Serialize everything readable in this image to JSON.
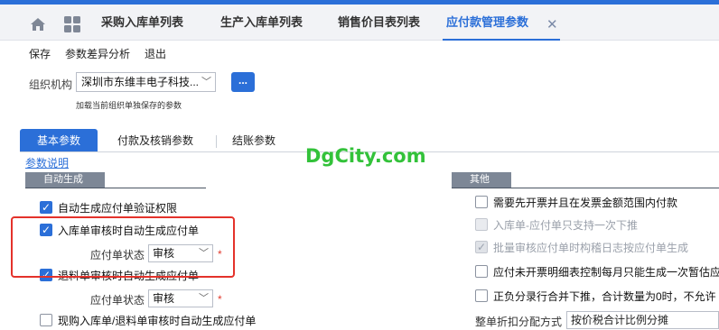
{
  "tabs": [
    {
      "label": "采购入库单列表"
    },
    {
      "label": "生产入库单列表"
    },
    {
      "label": "销售价目表列表"
    },
    {
      "label": "应付款管理参数",
      "active": true
    }
  ],
  "toolbar": {
    "save": "保存",
    "diff": "参数差异分析",
    "exit": "退出"
  },
  "org": {
    "label": "组织机构",
    "value": "深圳市东维丰电子科技...",
    "more": "...",
    "hint": "加载当前组织单独保存的参数"
  },
  "subtabs": [
    "基本参数",
    "付款及核销参数",
    "结账参数"
  ],
  "help_link": "参数说明",
  "left": {
    "section": "自动生成",
    "items": [
      {
        "label": "自动生成应付单验证权限",
        "checked": true
      },
      {
        "label": "入库单审核时自动生成应付单",
        "checked": true
      },
      {
        "label": "退料单审核时自动生成应付单",
        "checked": true
      },
      {
        "label": "现购入库单/退料单审核时自动生成应付单",
        "checked": false
      }
    ],
    "status_label": "应付单状态",
    "status_value_1": "审核",
    "status_value_2": "审核",
    "required": "*"
  },
  "right": {
    "section": "其他",
    "items": [
      {
        "label": "需要先开票并且在发票金额范围内付款",
        "state": "unchecked"
      },
      {
        "label": "入库单-应付单只支持一次下推",
        "state": "disabled"
      },
      {
        "label": "批量审核应付单时构稽日志按应付单生成",
        "state": "checked-disabled"
      },
      {
        "label": "应付未开票明细表控制每月只能生成一次暂估应",
        "state": "unchecked"
      },
      {
        "label": "正负分录行合并下推，合计数量为0时，不允许",
        "state": "unchecked"
      }
    ],
    "discount_label": "整单折扣分配方式",
    "discount_value": "按价税合计比例分摊"
  },
  "watermark": "DgCity.com",
  "colors": {
    "accent": "#2b6fd8",
    "highlight": "#e4322b",
    "watermark": "#33c23a"
  }
}
